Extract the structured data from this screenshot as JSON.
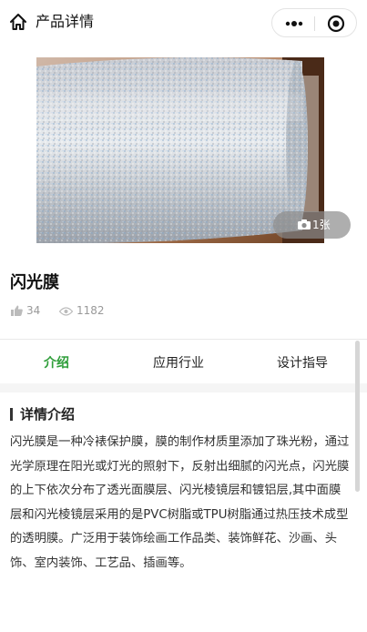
{
  "nav": {
    "title": "产品详情"
  },
  "product": {
    "title": "闪光膜",
    "likes": "34",
    "views": "1182",
    "photo_badge": "1张"
  },
  "tabs": [
    {
      "label": "介绍",
      "active": true
    },
    {
      "label": "应用行业",
      "active": false
    },
    {
      "label": "设计指导",
      "active": false
    }
  ],
  "section": {
    "heading": "详情介绍",
    "text": "闪光膜是一种冷裱保护膜，膜的制作材质里添加了珠光粉，通过光学原理在阳光或灯光的照射下，反射出细腻的闪光点，闪光膜的上下依次分布了透光面膜层、闪光棱镜层和镀铝层,其中面膜层和闪光棱镜层采用的是PVC树脂或TPU树脂通过热压技术成型的透明膜。广泛用于装饰绘画工作品类、装饰鲜花、沙画、头饰、室内装饰、工艺品、插画等。"
  },
  "colors": {
    "accent": "#2f9e3a",
    "text": "#333333",
    "muted": "#999999"
  }
}
